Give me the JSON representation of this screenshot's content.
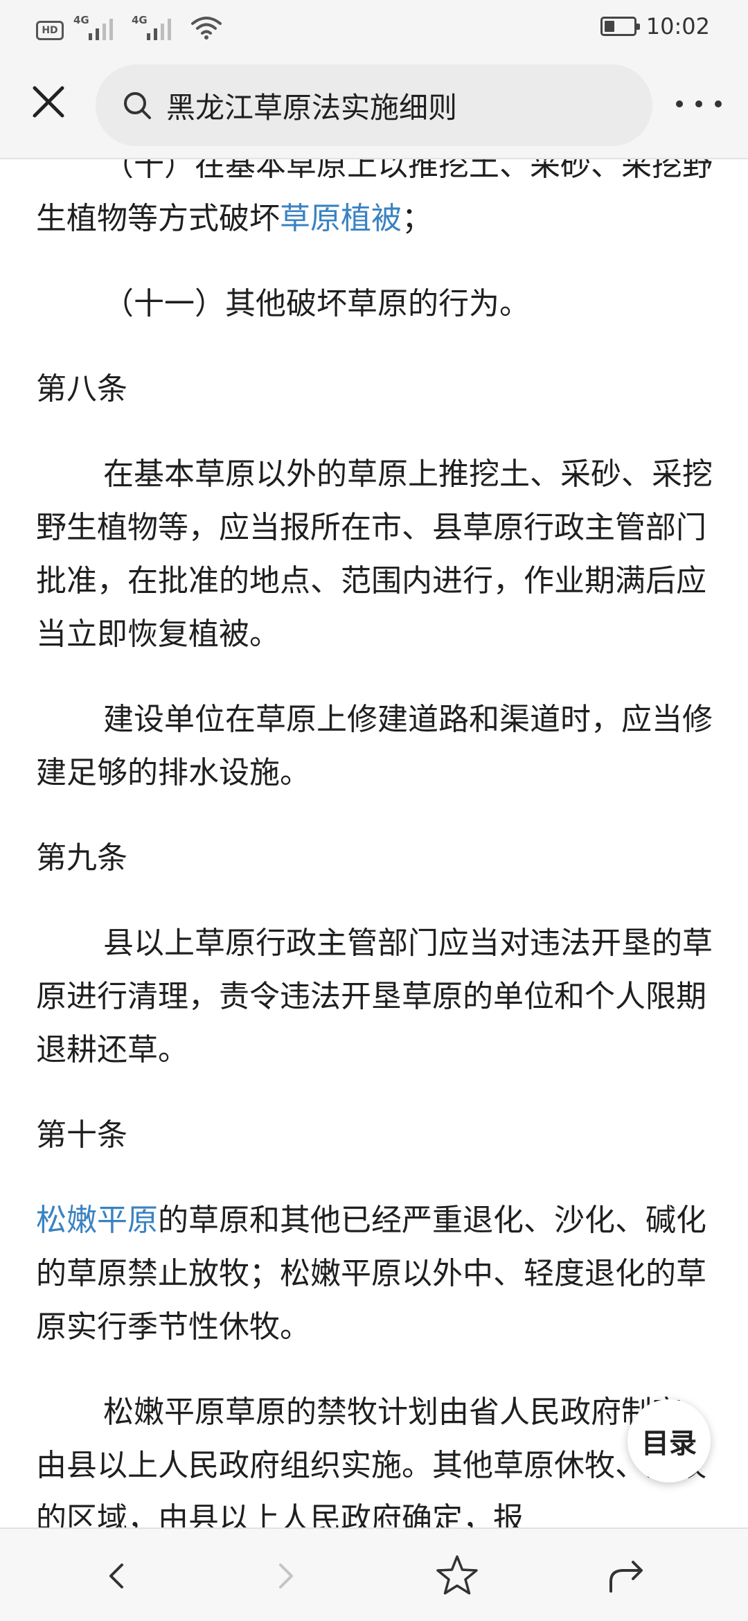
{
  "status_bar": {
    "hd": "HD",
    "sim1_type": "4G",
    "sim2_type": "4G",
    "time": "10:02"
  },
  "top_bar": {
    "search_text": "黑龙江草原法实施细则"
  },
  "article": {
    "p1_before": "（十）在基本草原上以推挖土、采砂、采挖野生植物等方式破坏",
    "p1_link": "草原植被",
    "p1_after": "；",
    "p2": "（十一）其他破坏草原的行为。",
    "h8": "第八条",
    "p3": "在基本草原以外的草原上推挖土、采砂、采挖野生植物等，应当报所在市、县草原行政主管部门批准，在批准的地点、范围内进行，作业期满后应当立即恢复植被。",
    "p4": "建设单位在草原上修建道路和渠道时，应当修建足够的排水设施。",
    "h9": "第九条",
    "p5": "县以上草原行政主管部门应当对违法开垦的草原进行清理，责令违法开垦草原的单位和个人限期退耕还草。",
    "h10": "第十条",
    "p6_link": "松嫩平原",
    "p6_after": "的草原和其他已经严重退化、沙化、碱化的草原禁止放牧；松嫩平原以外中、轻度退化的草原实行季节性休牧。",
    "p7": "松嫩平原草原的禁牧计划由省人民政府制定，由县以上人民政府组织实施。其他草原休牧、禁牧的区域，由县以上人民政府确定，报"
  },
  "toc_button": {
    "label": "目录"
  },
  "icons": {
    "close": "close-icon",
    "search": "search-icon",
    "more": "more-dots-icon",
    "back": "chevron-left-icon",
    "forward": "chevron-right-icon",
    "favorite": "star-icon",
    "share": "share-icon"
  },
  "colors": {
    "link": "#3a82c2",
    "bar_bg": "#f5f5f5",
    "forward_disabled": "#c4c4c4"
  }
}
